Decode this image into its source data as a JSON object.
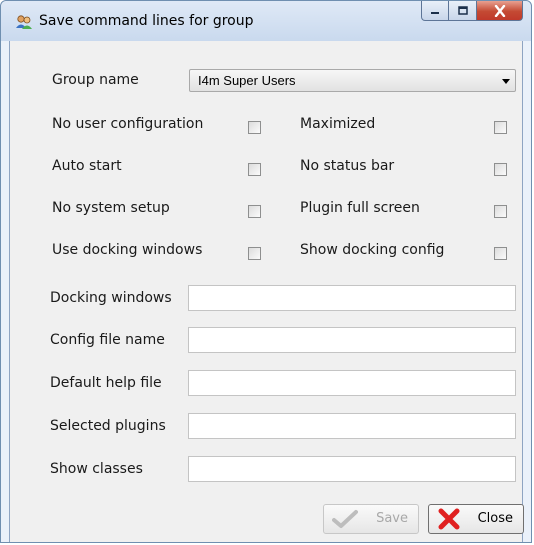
{
  "window": {
    "title": "Save command lines for group"
  },
  "form": {
    "group_name_label": "Group name",
    "group_name_value": "I4m Super Users",
    "checkboxes_left": [
      {
        "label": "No user configuration",
        "checked": false
      },
      {
        "label": "Auto start",
        "checked": false
      },
      {
        "label": "No system setup",
        "checked": false
      },
      {
        "label": "Use docking windows",
        "checked": false
      }
    ],
    "checkboxes_right": [
      {
        "label": "Maximized",
        "checked": false
      },
      {
        "label": "No status bar",
        "checked": false
      },
      {
        "label": "Plugin full screen",
        "checked": false
      },
      {
        "label": "Show docking config",
        "checked": false
      }
    ],
    "fields": [
      {
        "label": "Docking windows",
        "value": ""
      },
      {
        "label": "Config file name",
        "value": ""
      },
      {
        "label": "Default help file",
        "value": ""
      },
      {
        "label": "Selected plugins",
        "value": ""
      },
      {
        "label": "Show classes",
        "value": ""
      }
    ]
  },
  "buttons": {
    "save_label": "Save",
    "close_label": "Close"
  },
  "colors": {
    "close_caption": "#c44a33",
    "disabled_text": "#a8a8a8"
  },
  "icons": {
    "app": "users-group-icon",
    "minimize": "minimize-icon",
    "maximize": "maximize-icon",
    "close": "close-icon",
    "save": "checkmark-icon",
    "close_button": "red-x-icon"
  }
}
